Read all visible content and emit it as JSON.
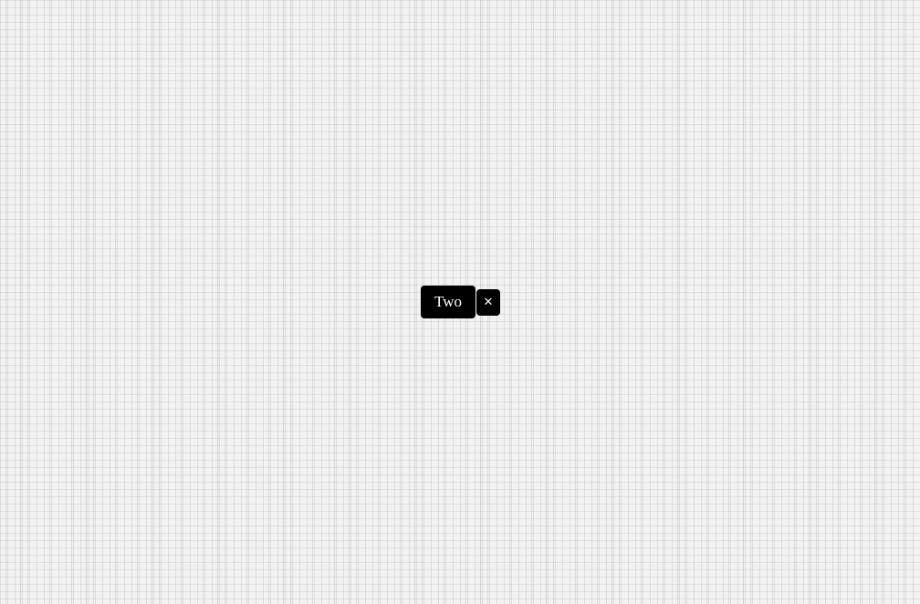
{
  "canvas": {
    "background_color": "#f2f2f2",
    "grid_line_color": "#cccccc"
  },
  "tag": {
    "label": "Two",
    "remove_icon": "close-icon",
    "remove_glyph": "✕",
    "background_color": "#000000",
    "text_color": "#ffffff"
  }
}
